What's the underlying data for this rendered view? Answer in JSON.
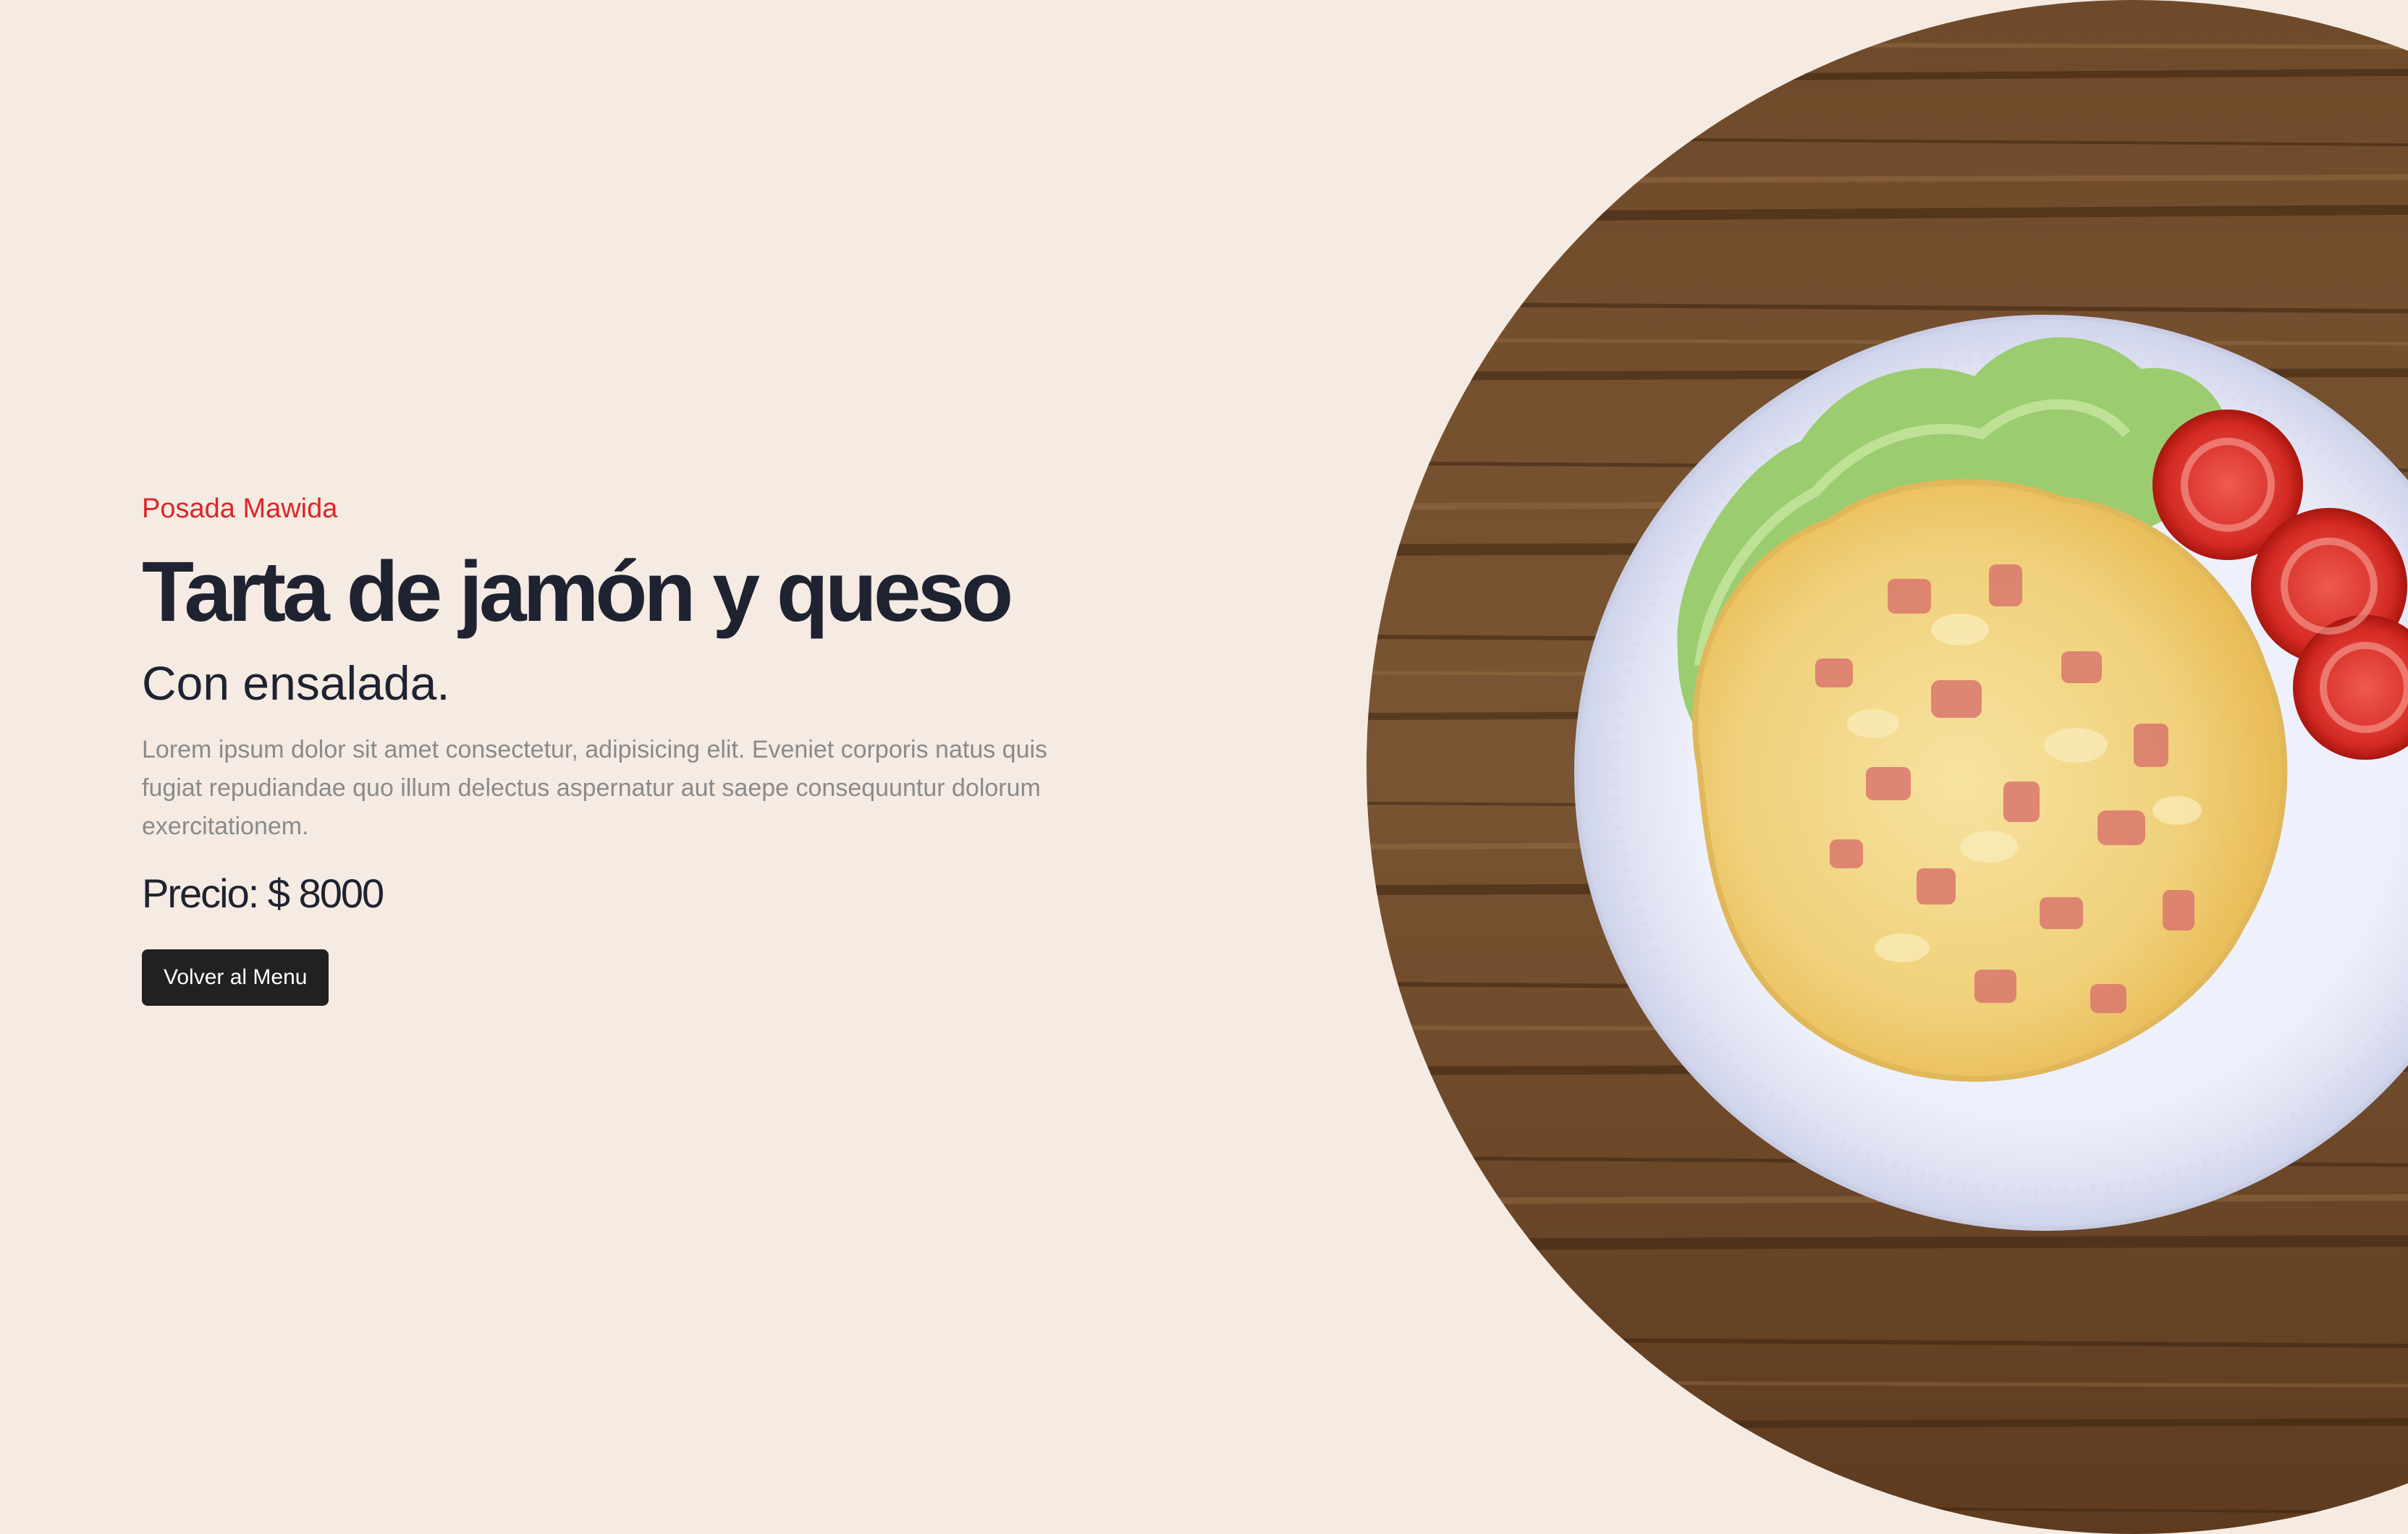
{
  "eyebrow": "Posada Mawida",
  "title": "Tarta de jamón y queso",
  "subtitle": "Con ensalada.",
  "description": "Lorem ipsum dolor sit amet consectetur, adipisicing elit. Eveniet corporis natus quis fugiat repudiandae quo illum delectus aspernatur aut saepe consequuntur dolorum exercitationem.",
  "price": {
    "label": "Precio:",
    "amount": "$ 8000"
  },
  "button": {
    "label": "Volver al Menu"
  },
  "image": {
    "icon": "food-photo-icon"
  },
  "colors": {
    "background": "#f5ebe3",
    "accent": "#dc2626",
    "heading": "#1f2230",
    "button": "#212121"
  }
}
